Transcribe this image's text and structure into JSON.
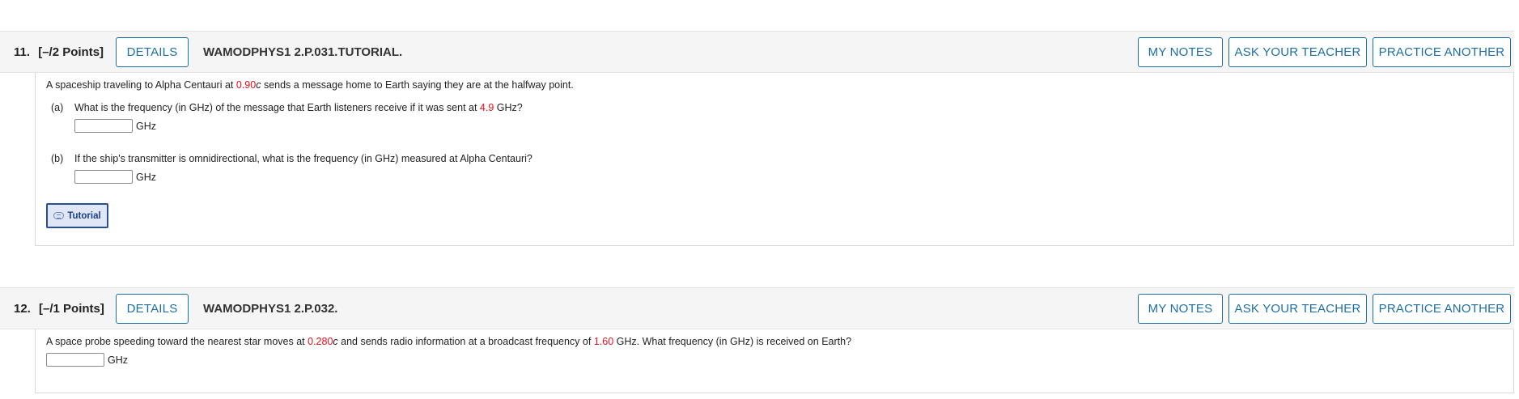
{
  "questions": [
    {
      "number": "11.",
      "points": "[–/2 Points]",
      "details_label": "DETAILS",
      "code": "WAMODPHYS1 2.P.031.TUTORIAL.",
      "notes_label": "MY NOTES",
      "ask_label": "ASK YOUR TEACHER",
      "practice_label": "PRACTICE ANOTHER",
      "intro": {
        "pre": "A spaceship traveling to Alpha Centauri at ",
        "value": "0.90",
        "var": "c",
        "post": " sends a message home to Earth saying they are at the halfway point."
      },
      "parts": [
        {
          "label": "(a)",
          "pre": "What is the frequency (in GHz) of the message that Earth listeners receive if it was sent at ",
          "value": "4.9",
          "post": " GHz?",
          "input_value": "",
          "unit": "GHz"
        },
        {
          "label": "(b)",
          "text": "If the ship's transmitter is omnidirectional, what is the frequency (in GHz) measured at Alpha Centauri?",
          "input_value": "",
          "unit": "GHz"
        }
      ],
      "tutorial_label": "Tutorial"
    },
    {
      "number": "12.",
      "points": "[–/1 Points]",
      "details_label": "DETAILS",
      "code": "WAMODPHYS1 2.P.032.",
      "notes_label": "MY NOTES",
      "ask_label": "ASK YOUR TEACHER",
      "practice_label": "PRACTICE ANOTHER",
      "text": {
        "pre": "A space probe speeding toward the nearest star moves at ",
        "value1": "0.280",
        "var": "c",
        "mid": " and sends radio information at a broadcast frequency of ",
        "value2": "1.60",
        "post": " GHz. What frequency (in GHz) is received on Earth?"
      },
      "input_value": "",
      "unit": "GHz"
    }
  ],
  "colors": {
    "accent": "#1d6fa3",
    "highlight": "#e8101a",
    "header_bg": "#f5f5f5",
    "tutorial_bg": "#dfe6f5"
  }
}
